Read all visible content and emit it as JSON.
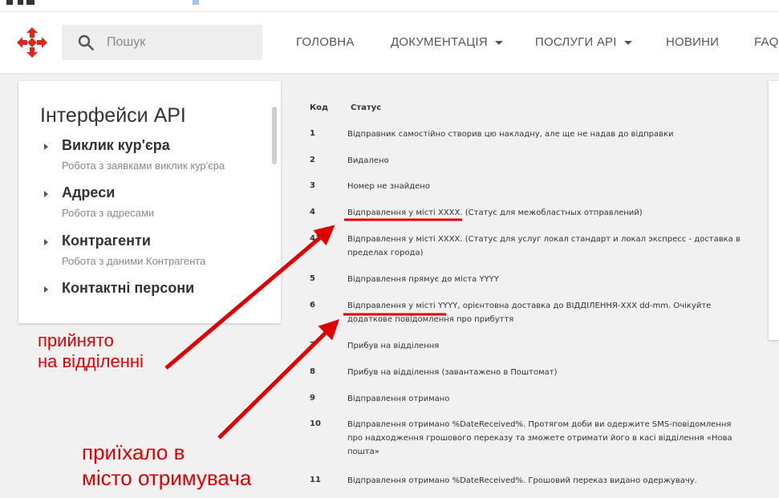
{
  "header": {
    "search_placeholder": "Пошук",
    "nav": [
      {
        "label": "ГОЛОВНА",
        "dropdown": false
      },
      {
        "label": "ДОКУМЕНТАЦІЯ",
        "dropdown": true
      },
      {
        "label": "ПОСЛУГИ API",
        "dropdown": true
      },
      {
        "label": "НОВИНИ",
        "dropdown": false
      },
      {
        "label": "FAQ",
        "dropdown": false
      }
    ]
  },
  "sidebar": {
    "title": "Інтерфейси API",
    "items": [
      {
        "label": "Виклик кур'єра",
        "sub": "Робота з заявками виклик кур'єра"
      },
      {
        "label": "Адреси",
        "sub": "Робота з адресами"
      },
      {
        "label": "Контрагенти",
        "sub": "Робота з даними Контрагента"
      },
      {
        "label": "Контактні персони",
        "sub": ""
      }
    ]
  },
  "table": {
    "headers": {
      "code": "Код",
      "status": "Статус"
    },
    "rows": [
      {
        "code": "1",
        "status": "Відправник самостійно створив цю накладну, але ще не надав до відправки"
      },
      {
        "code": "2",
        "status": "Видалено"
      },
      {
        "code": "3",
        "status": "Номер не знайдено"
      },
      {
        "code": "4",
        "status": "Відправлення у місті ХХХХ. (Статус для межобластных отправлений)"
      },
      {
        "code": "41",
        "status": "Відправлення у місті ХХХХ. (Статус для услуг локал стандарт и локал экспресс - доставка в пределах города)"
      },
      {
        "code": "5",
        "status": "Відправлення прямує до міста YYYY"
      },
      {
        "code": "6",
        "status": "Відправлення у місті YYYY, орієнтовна доставка до ВІДДІЛЕННЯ-XXX dd-mm. Очікуйте додаткове повідомлення про прибуття"
      },
      {
        "code": "7",
        "status": "Прибув на відділення"
      },
      {
        "code": "8",
        "status": "Прибув на відділення (завантажено в Поштомат)"
      },
      {
        "code": "9",
        "status": "Відправлення отримано"
      },
      {
        "code": "10",
        "status": "Відправлення отримано %DateReceived%. Протягом доби ви одержите SMS-повідомлення про надходження грошового переказу та зможете отримати його в касі відділення «Нова пошта»"
      },
      {
        "code": "11",
        "status": "Відправлення отримано %DateReceived%. Грошовий переказ видано одержувачу."
      }
    ]
  },
  "annotations": {
    "received_at_branch": [
      "прийнято",
      "на відділенні"
    ],
    "arrived_in_city": [
      "приїхало в",
      "місто отримувача"
    ],
    "color": "#e00000"
  },
  "colors": {
    "brand_red": "#da291c",
    "page_bg": "#f1f1f1"
  },
  "icons": {
    "logo": "nova-poshta-logo-icon",
    "search": "search-icon"
  }
}
